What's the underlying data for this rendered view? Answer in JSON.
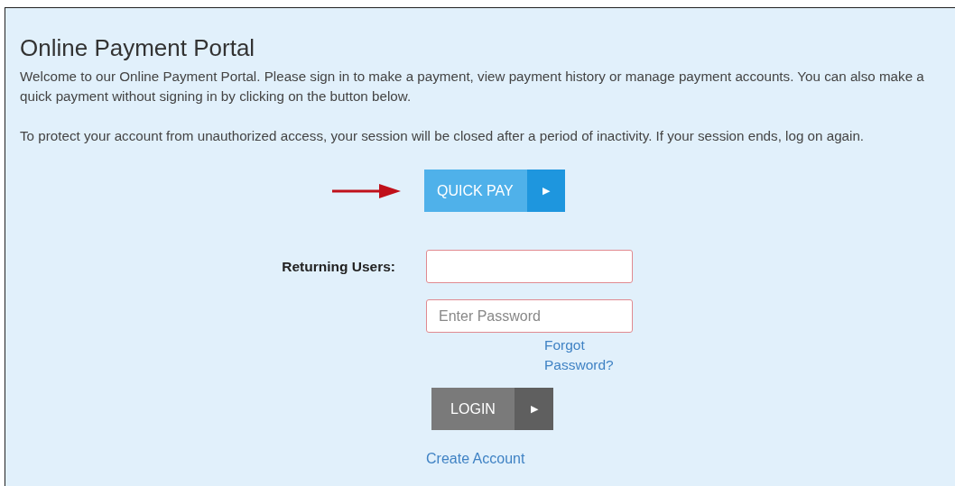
{
  "title": "Online Payment Portal",
  "paragraphs": [
    "Welcome to our Online Payment Portal. Please sign in to make a payment, view payment history or manage payment accounts. You can also make a quick payment without signing in by clicking on the button below.",
    "To protect your account from unauthorized access, your session will be closed after a period of inactivity. If your session ends, log on again."
  ],
  "quick_pay_button": {
    "label": "QUICK PAY",
    "icon": "▶"
  },
  "login_form": {
    "label": "Returning Users:",
    "password": {
      "placeholder": "Enter Password"
    },
    "forgot_link": "Forgot Password?",
    "login_button": {
      "label": "LOGIN",
      "icon": "▶"
    },
    "create_account_link": "Create Account"
  }
}
